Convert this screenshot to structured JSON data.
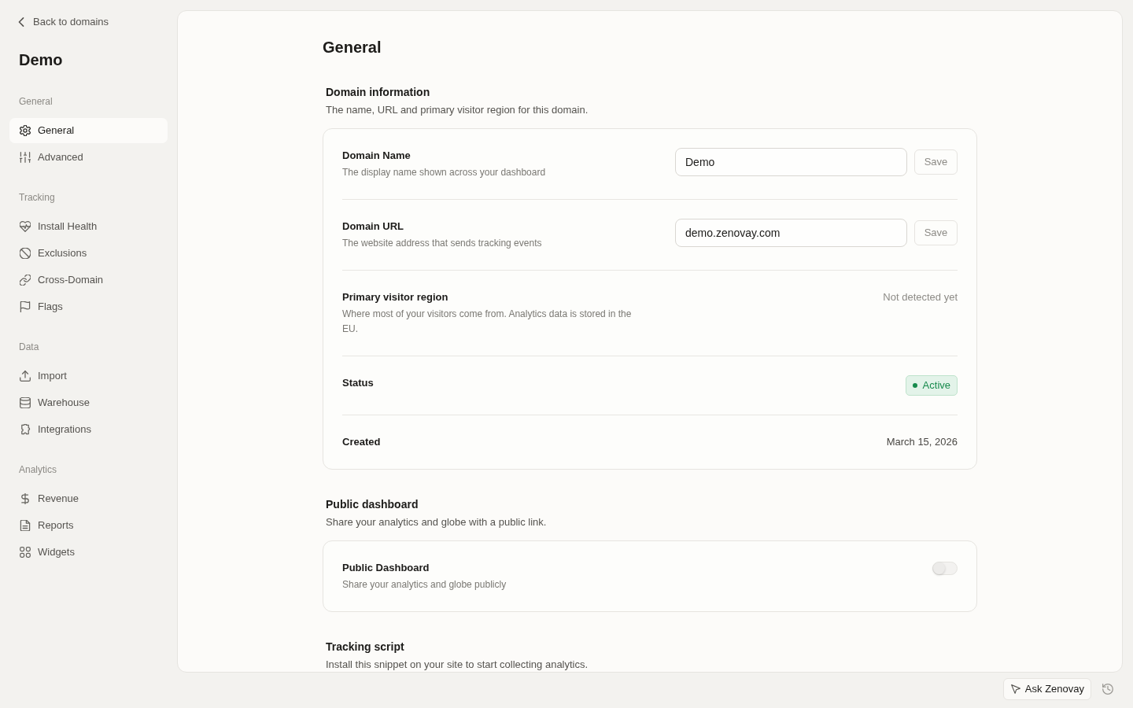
{
  "sidebar": {
    "back_link": "Back to domains",
    "title": "Demo",
    "groups": [
      {
        "heading": "General",
        "items": [
          {
            "label": "General",
            "selected": true
          },
          {
            "label": "Advanced",
            "selected": false
          }
        ]
      },
      {
        "heading": "Tracking",
        "items": [
          {
            "label": "Install Health",
            "selected": false
          },
          {
            "label": "Exclusions",
            "selected": false
          },
          {
            "label": "Cross-Domain",
            "selected": false
          },
          {
            "label": "Flags",
            "selected": false
          }
        ]
      },
      {
        "heading": "Data",
        "items": [
          {
            "label": "Import",
            "selected": false
          },
          {
            "label": "Warehouse",
            "selected": false
          },
          {
            "label": "Integrations",
            "selected": false
          }
        ]
      },
      {
        "heading": "Analytics",
        "items": [
          {
            "label": "Revenue",
            "selected": false
          },
          {
            "label": "Reports",
            "selected": false
          },
          {
            "label": "Widgets",
            "selected": false
          }
        ]
      }
    ]
  },
  "main": {
    "title": "General",
    "sections": [
      {
        "title": "Domain information",
        "description": "The name, URL and primary visitor region for this domain.",
        "rows": [
          {
            "kind": "input",
            "label": "Domain Name",
            "description": "The display name shown across your dashboard",
            "value": "Demo",
            "button": {
              "label": "Save",
              "disabled": true
            }
          },
          {
            "kind": "input",
            "label": "Domain URL",
            "description": "The website address that sends tracking events",
            "value": "demo.zenovay.com",
            "button": {
              "label": "Save",
              "disabled": true
            }
          },
          {
            "kind": "text",
            "label": "Primary visitor region",
            "description": "Where most of your visitors come from. Analytics data is stored in the EU.",
            "value": "Not detected yet",
            "muted": true
          },
          {
            "kind": "status",
            "label": "Status",
            "value": "Active"
          },
          {
            "kind": "text",
            "label": "Created",
            "value": "March 15, 2026",
            "muted": false
          }
        ]
      },
      {
        "title": "Public dashboard",
        "description": "Share your analytics and globe with a public link.",
        "rows": [
          {
            "kind": "toggle",
            "label": "Public Dashboard",
            "description": "Share your analytics and globe publicly",
            "on": false
          }
        ]
      },
      {
        "title": "Tracking script",
        "description": "Install this snippet on your site to start collecting analytics."
      }
    ]
  },
  "footer": {
    "ask_button": "Ask Zenovay"
  }
}
